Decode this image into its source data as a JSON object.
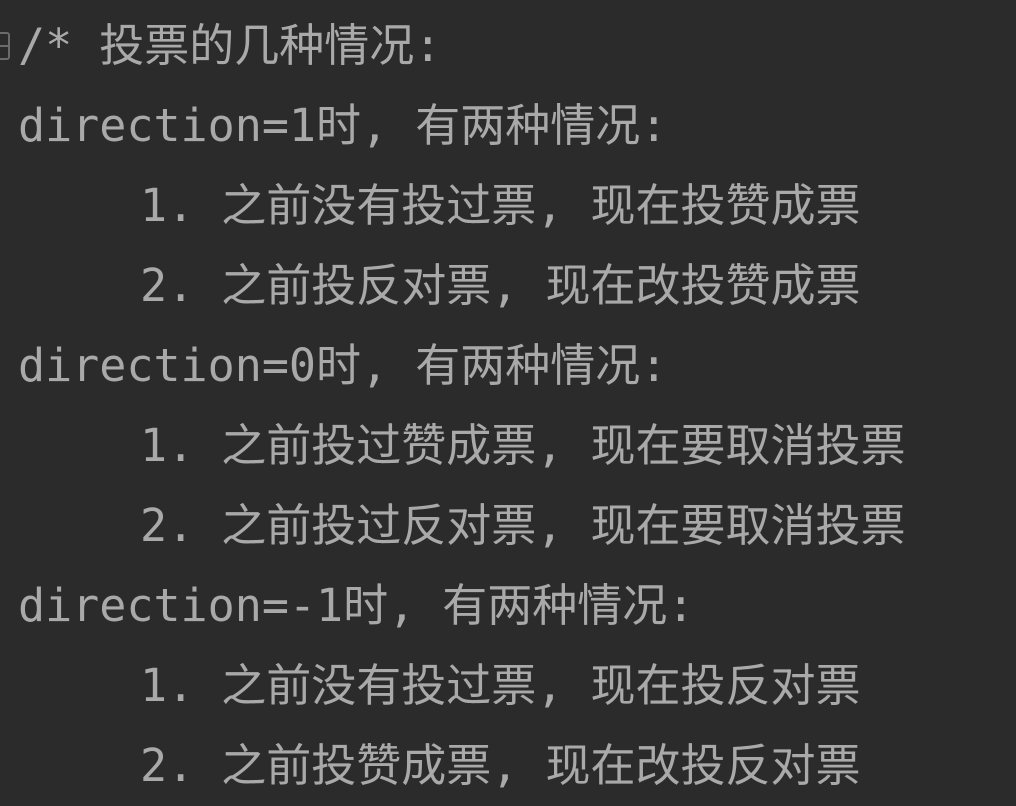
{
  "editor": {
    "colors": {
      "background": "#2b2b2b",
      "comment_text": "#a9a9a9",
      "gutter_marker": "#6b6b6b"
    },
    "gutter": {
      "fold_icon": "fold-collapse-icon"
    },
    "lines": [
      "/* 投票的几种情况:",
      "direction=1时, 有两种情况:",
      "1. 之前没有投过票, 现在投赞成票",
      "2. 之前投反对票, 现在改投赞成票",
      "direction=0时, 有两种情况:",
      "1. 之前投过赞成票, 现在要取消投票",
      "2. 之前投过反对票, 现在要取消投票",
      "direction=-1时, 有两种情况:",
      "1. 之前没有投过票, 现在投反对票",
      "2. 之前投赞成票, 现在改投反对票"
    ]
  }
}
